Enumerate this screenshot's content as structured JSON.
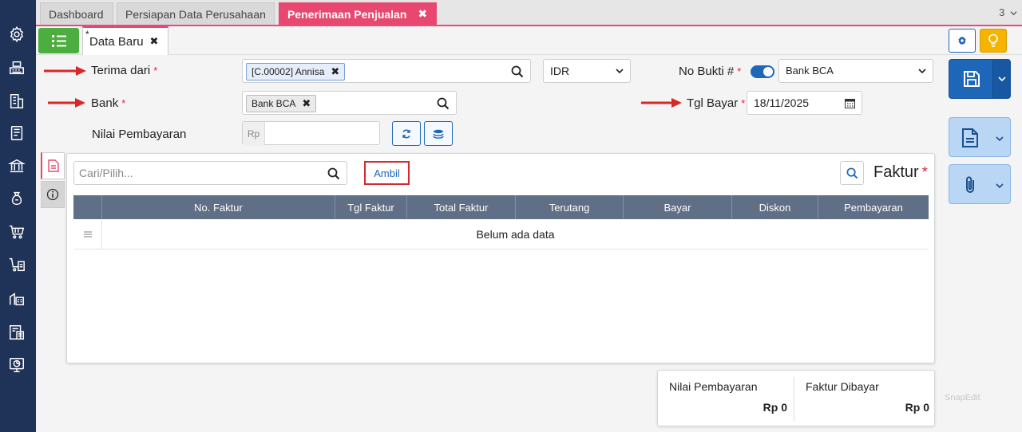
{
  "colors": {
    "sidebar": "#1f3358",
    "accent": "#e8486f",
    "primary": "#1e66b8",
    "green": "#4cae3f",
    "required": "#e0203a",
    "annotation": "#d62828"
  },
  "sidebar": {
    "icons": [
      "gear-icon",
      "cash-register-icon",
      "building-icon",
      "notebook-icon",
      "bank-icon",
      "money-bag-icon",
      "cart-icon",
      "cart-list-icon",
      "warehouse-icon",
      "tax-icon",
      "chart-icon"
    ]
  },
  "tabs": [
    {
      "label": "Dashboard"
    },
    {
      "label": "Persiapan Data Perusahaan"
    },
    {
      "label": "Penerimaan Penjualan",
      "close": "✖"
    }
  ],
  "tab_count": "3",
  "subtab": {
    "modified_marker": "*",
    "label": "Data Baru",
    "close": "✖"
  },
  "form": {
    "terima_dari": {
      "label": "Terima dari",
      "required": "*",
      "chip": "[C.00002] Annisa",
      "chip_remove": "✖"
    },
    "currency": {
      "value": "IDR"
    },
    "no_bukti": {
      "label": "No Bukti #",
      "required": "*",
      "value": "Bank BCA"
    },
    "bank": {
      "label": "Bank",
      "required": "*",
      "chip": "Bank BCA",
      "chip_remove": "✖"
    },
    "tgl_bayar": {
      "label": "Tgl Bayar",
      "required": "*",
      "value": "18/11/2025"
    },
    "nilai_pembayaran": {
      "label": "Nilai Pembayaran",
      "prefix": "Rp",
      "value": ""
    }
  },
  "panel": {
    "search_placeholder": "Cari/Pilih...",
    "ambil_label": "Ambil",
    "title": "Faktur",
    "title_required": "*",
    "columns": [
      "No. Faktur",
      "Tgl Faktur",
      "Total Faktur",
      "Terutang",
      "Bayar",
      "Diskon",
      "Pembayaran"
    ],
    "empty_text": "Belum ada data"
  },
  "summary": {
    "nilai_pembayaran": {
      "label": "Nilai Pembayaran",
      "value": "Rp 0"
    },
    "faktur_dibayar": {
      "label": "Faktur Dibayar",
      "value": "Rp 0"
    }
  },
  "watermark": "SnapEdit"
}
